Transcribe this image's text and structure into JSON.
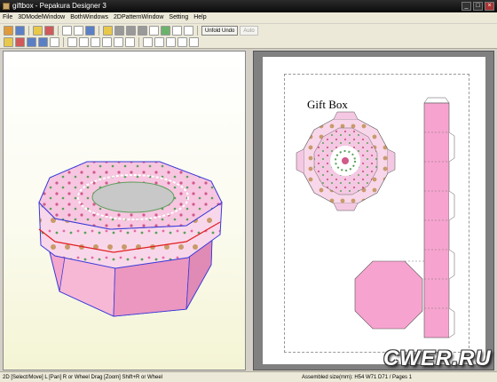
{
  "window": {
    "title": "giftbox - Pepakura Designer 3",
    "minimize_label": "_",
    "maximize_label": "□",
    "close_label": "×"
  },
  "menu": {
    "items": [
      "File",
      "3DModelWindow",
      "BothWindows",
      "2DPatternWindow",
      "Setting",
      "Help"
    ]
  },
  "toolbar": {
    "unfold_undo_label": "Unfold Undo",
    "auto_label": "Auto"
  },
  "pattern": {
    "title": "Gift Box"
  },
  "status": {
    "left": "2D [Select/Move] L [Pan] R or Wheel Drag [Zoom] Shift+R or Wheel",
    "right": "Assembled size(mm): H54 W71 D71 / Pages 1"
  },
  "watermark": "CWER.RU",
  "colors": {
    "pink": "#f7a3cf",
    "light_pink": "#f9d7ea",
    "edge_red": "#e02020",
    "edge_blue": "#3a3ad8"
  }
}
